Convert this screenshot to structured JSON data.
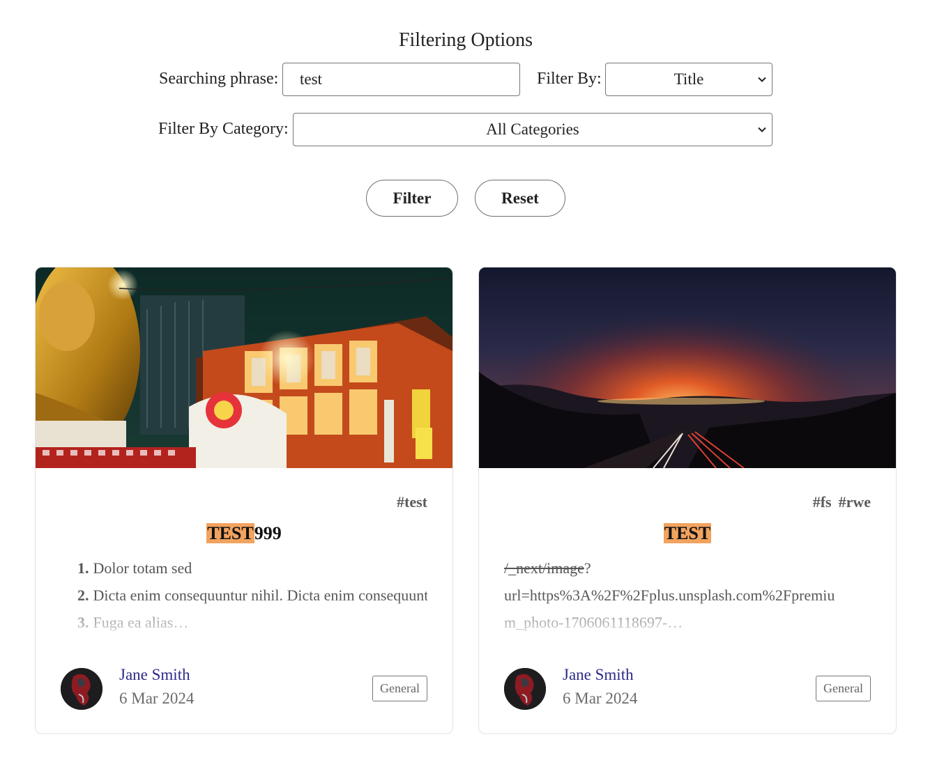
{
  "filters": {
    "title": "Filtering Options",
    "search_label": "Searching phrase:",
    "search_value": "test",
    "filter_by_label": "Filter By:",
    "filter_by_value": "Title",
    "category_label": "Filter By Category:",
    "category_value": "All Categories",
    "filter_button": "Filter",
    "reset_button": "Reset"
  },
  "colors": {
    "highlight": "#f2a35f",
    "author_link": "#2b2a8a"
  },
  "posts": [
    {
      "image": "night street with illuminated festival float and golden statue",
      "tags": [
        "#test"
      ],
      "title_highlight": "TEST",
      "title_rest": "999",
      "excerpt_items": [
        {
          "num": "1.",
          "text": "Dolor totam sed"
        },
        {
          "num": "2.",
          "text": "Dicta enim consequuntur nihil. Dicta enim consequuntur nihil."
        },
        {
          "num": "3.",
          "text": "Fuga ea alias…"
        }
      ],
      "author": "Jane Smith",
      "date": "6 Mar 2024",
      "category": "General"
    },
    {
      "image": "sunset over mountains with highway light trails",
      "tags": [
        "#fs",
        "#rwe"
      ],
      "title_highlight": "TEST",
      "title_rest": "",
      "excerpt_strike": "/_next/image",
      "excerpt_line1_rest": "?",
      "excerpt_line2": "url=https%3A%2F%2Fplus.unsplash.com%2Fpremiu",
      "excerpt_line3": "m_photo-1706061118697-…",
      "author": "Jane Smith",
      "date": "6 Mar 2024",
      "category": "General"
    }
  ]
}
